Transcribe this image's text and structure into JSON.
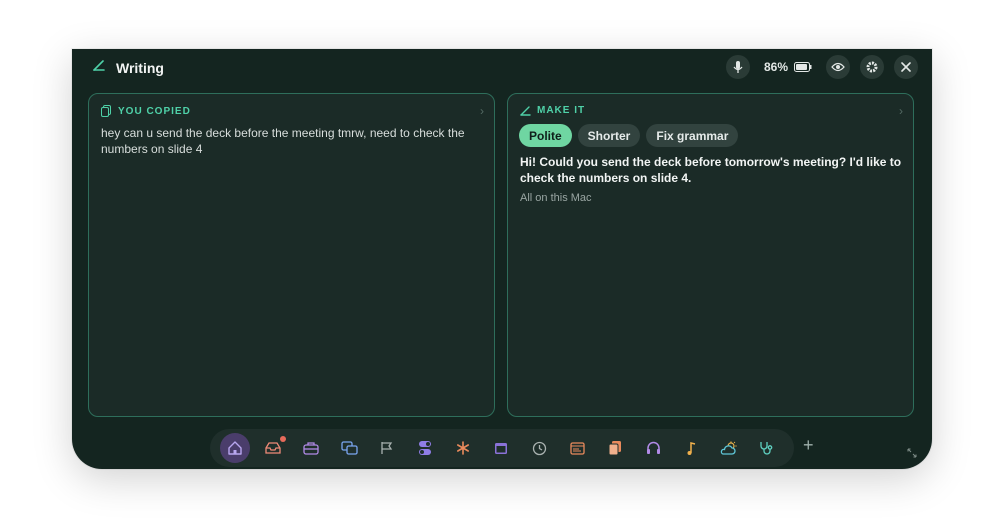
{
  "header": {
    "title": "Writing",
    "battery": "86%"
  },
  "left_card": {
    "label": "YOU COPIED",
    "text": "hey can u send the deck before the meeting tmrw, need to check the numbers on slide 4"
  },
  "right_card": {
    "label": "MAKE IT",
    "chips": [
      "Polite",
      "Shorter",
      "Fix grammar"
    ],
    "active_chip": "Polite",
    "result": "Hi! Could you send the deck before tomorrow's meeting? I'd like to check the numbers on slide 4.",
    "note": "All on this Mac"
  },
  "dock": {
    "items": [
      "home-icon",
      "inbox-icon",
      "briefcase-icon",
      "windows-icon",
      "flag-icon",
      "toggle-icon",
      "asterisk-icon",
      "calendar-icon",
      "timer-icon",
      "browser-icon",
      "notes-icon",
      "headphones-icon",
      "music-icon",
      "weather-icon",
      "stethoscope-icon"
    ],
    "add_label": "+"
  },
  "colors": {
    "accent": "#4fd1a8",
    "active_chip": "#6fd6a2",
    "window_bg": "#142520"
  }
}
